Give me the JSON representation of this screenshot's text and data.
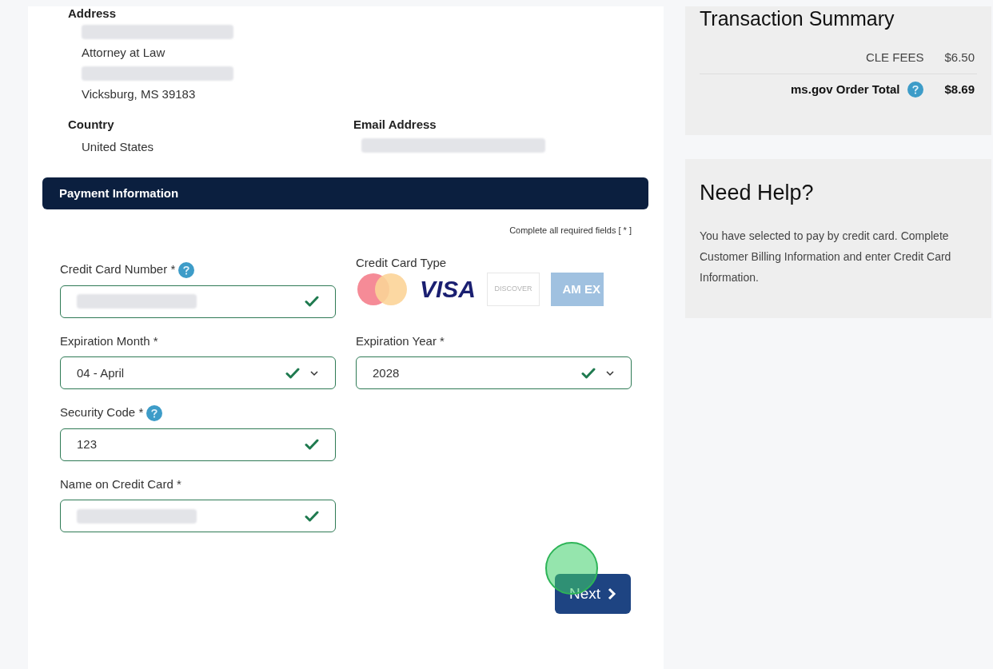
{
  "billing": {
    "address_label": "Address",
    "address_lines": [
      {
        "kind": "redacted"
      },
      {
        "kind": "text",
        "text": "Attorney at Law"
      },
      {
        "kind": "redacted"
      },
      {
        "kind": "text",
        "text": "Vicksburg, MS 39183"
      }
    ],
    "country_label": "Country",
    "country": "United States",
    "email_label": "Email Address",
    "email_redacted": true
  },
  "payment": {
    "title": "Payment Information",
    "required_note": "Complete all required fields [ * ]",
    "card_number": {
      "label": "Credit Card Number *",
      "help": true,
      "redacted": true,
      "valid": true
    },
    "card_type": {
      "label": "Credit Card Type",
      "cards": [
        {
          "kind": "mastercard",
          "selected": false
        },
        {
          "kind": "visa",
          "label": "VISA",
          "selected": true
        },
        {
          "kind": "discover",
          "label": "DISCOVER",
          "selected": false
        },
        {
          "kind": "amex",
          "label": "AM EX",
          "selected": false
        }
      ]
    },
    "expiration_month": {
      "label": "Expiration Month *",
      "value": "04 - April",
      "valid": true
    },
    "expiration_year": {
      "label": "Expiration Year *",
      "value": "2028",
      "valid": true
    },
    "security_code": {
      "label": "Security Code *",
      "help": true,
      "value": "123",
      "valid": true
    },
    "name_on_card": {
      "label": "Name on Credit Card *",
      "redacted": true,
      "valid": true
    },
    "next_button": "Next"
  },
  "summary": {
    "title": "Transaction Summary",
    "rows": [
      {
        "label": "CLE FEES",
        "amount": "$6.50",
        "total": false
      },
      {
        "label": "ms.gov Order Total",
        "amount": "$8.69",
        "total": true,
        "help": true
      }
    ]
  },
  "help": {
    "title": "Need Help?",
    "text": "You have selected to pay by credit card. Complete Customer Billing Information and enter Credit Card Information."
  }
}
